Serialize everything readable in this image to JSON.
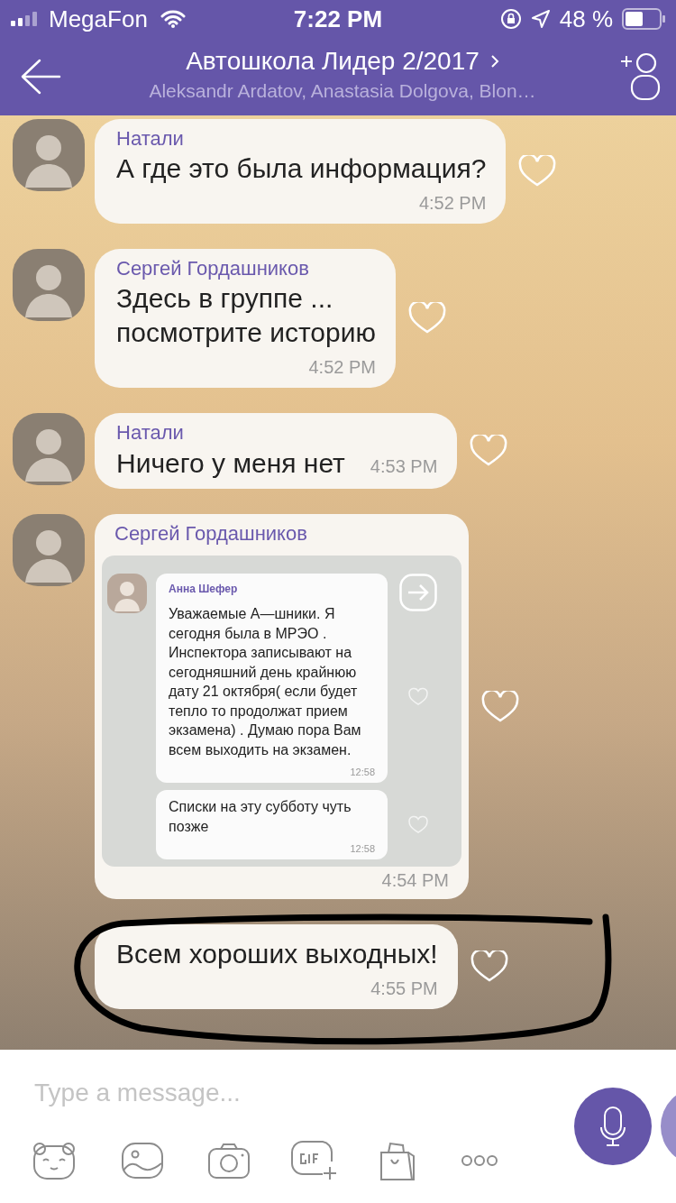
{
  "status_bar": {
    "carrier": "MegaFon",
    "time": "7:22 PM",
    "battery": "48 %"
  },
  "header": {
    "title": "Автошкола Лидер 2/2017",
    "subtitle": "Aleksandr Ardatov, Anastasia Dolgova, Blon…"
  },
  "messages": [
    {
      "kind": "text",
      "sender": "Натали",
      "text": "А где это была информация?",
      "time": "4:52 PM",
      "time_inline": false
    },
    {
      "kind": "text",
      "sender": "Сергей Гордашников",
      "text": "Здесь в группе ...\nпосмотрите историю",
      "time": "4:52 PM",
      "time_inline": false
    },
    {
      "kind": "text",
      "sender": "Натали",
      "text": "Ничего у меня нет",
      "time": "4:53 PM",
      "time_inline": true
    },
    {
      "kind": "forwarded_screenshot",
      "sender": "Сергей Гордашников",
      "time": "4:54 PM",
      "screenshot": {
        "sender": "Анна Шефер",
        "messages": [
          {
            "text": "Уважаемые А—шники. Я сегодня была в МРЭО . Инспектора записывают на сегодняшний день крайнюю дату 21 октября( если будет тепло то продолжат прием экзамена) . Думаю пора Вам всем выходить на экзамен.",
            "time": "12:58"
          },
          {
            "text": "Списки на эту субботу чуть позже",
            "time": "12:58"
          }
        ]
      }
    },
    {
      "kind": "text",
      "text": "Всем хороших выходных!",
      "time": "4:55 PM",
      "time_inline": false
    }
  ],
  "composer": {
    "placeholder": "Type a message..."
  }
}
